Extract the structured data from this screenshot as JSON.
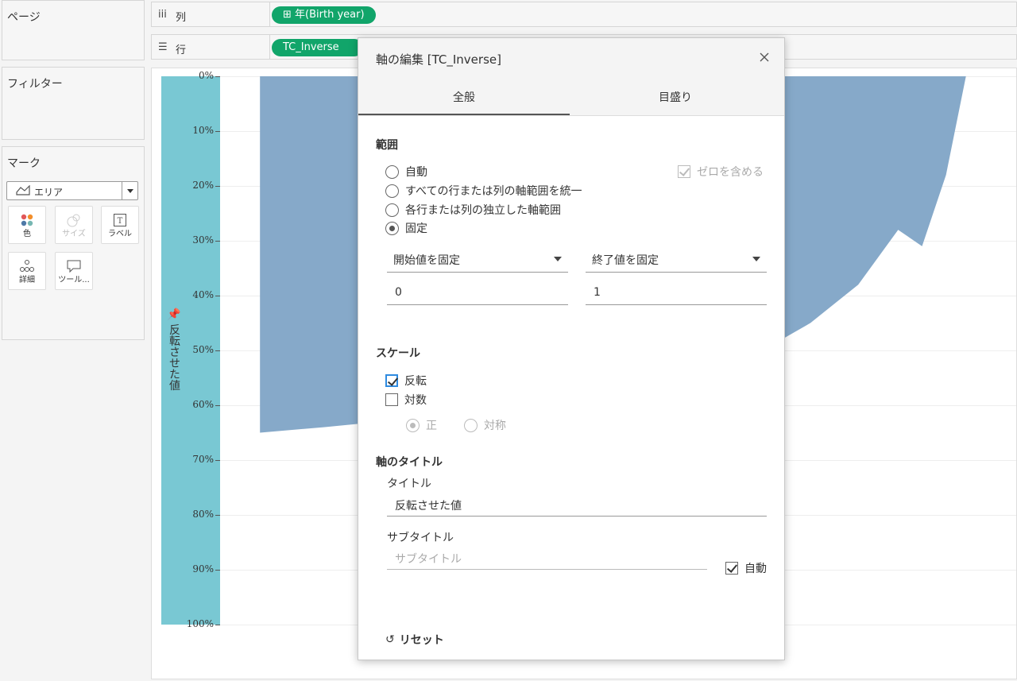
{
  "sidebar": {
    "pages_title": "ページ",
    "filters_title": "フィルター",
    "marks_title": "マーク",
    "mark_type": "エリア",
    "mark_cards": [
      {
        "label": "色",
        "icon": "color-dots-icon",
        "enabled": true
      },
      {
        "label": "サイズ",
        "icon": "size-icon",
        "enabled": false
      },
      {
        "label": "ラベル",
        "icon": "label-icon",
        "enabled": true
      },
      {
        "label": "詳細",
        "icon": "detail-icon",
        "enabled": true
      },
      {
        "label": "ツール...",
        "icon": "tooltip-icon",
        "enabled": true
      }
    ]
  },
  "shelves": {
    "columns_label": "列",
    "columns_pill": "年(Birth year)",
    "rows_label": "行",
    "rows_pill": "TC_Inverse"
  },
  "chart": {
    "axis_title": "反転させた値",
    "ticks": [
      "0%",
      "10%",
      "20%",
      "30%",
      "40%",
      "50%",
      "60%",
      "70%",
      "80%",
      "90%",
      "100%"
    ]
  },
  "chart_data": {
    "type": "area",
    "ylabel": "反転させた値",
    "ylim": [
      0,
      1
    ],
    "y_reversed": true,
    "series": [
      {
        "name": "TC_Inverse",
        "points": [
          [
            0.05,
            0.65
          ],
          [
            0.13,
            0.64
          ],
          [
            0.2,
            0.63
          ],
          [
            0.26,
            0.61
          ],
          [
            0.3,
            0.62
          ],
          [
            0.34,
            0.61
          ],
          [
            0.42,
            0.58
          ],
          [
            0.5,
            0.55
          ],
          [
            0.56,
            0.54
          ],
          [
            0.62,
            0.52
          ],
          [
            0.68,
            0.5
          ],
          [
            0.74,
            0.45
          ],
          [
            0.8,
            0.38
          ],
          [
            0.85,
            0.28
          ],
          [
            0.88,
            0.31
          ],
          [
            0.91,
            0.18
          ],
          [
            0.935,
            0.0
          ]
        ]
      }
    ],
    "color": "#86a9c9",
    "band_color": "#79c8d3"
  },
  "dialog": {
    "title": "軸の編集 [TC_Inverse]",
    "tabs": [
      "全般",
      "目盛り"
    ],
    "active_tab": 0,
    "range": {
      "heading": "範囲",
      "options": [
        "自動",
        "すべての行または列の軸範囲を統一",
        "各行または列の独立した軸範囲",
        "固定"
      ],
      "selected": 3,
      "include_zero": "ゼロを含める",
      "start_mode": "開始値を固定",
      "end_mode": "終了値を固定",
      "start_value": "0",
      "end_value": "1"
    },
    "scale": {
      "heading": "スケール",
      "reversed_label": "反転",
      "reversed": true,
      "log_label": "対数",
      "log": false,
      "positive_label": "正",
      "symmetric_label": "対称"
    },
    "axis_title": {
      "heading": "軸のタイトル",
      "title_label": "タイトル",
      "title_value": "反転させた値",
      "subtitle_label": "サブタイトル",
      "subtitle_placeholder": "サブタイトル",
      "auto_label": "自動",
      "auto": true
    },
    "reset_label": "リセット"
  }
}
